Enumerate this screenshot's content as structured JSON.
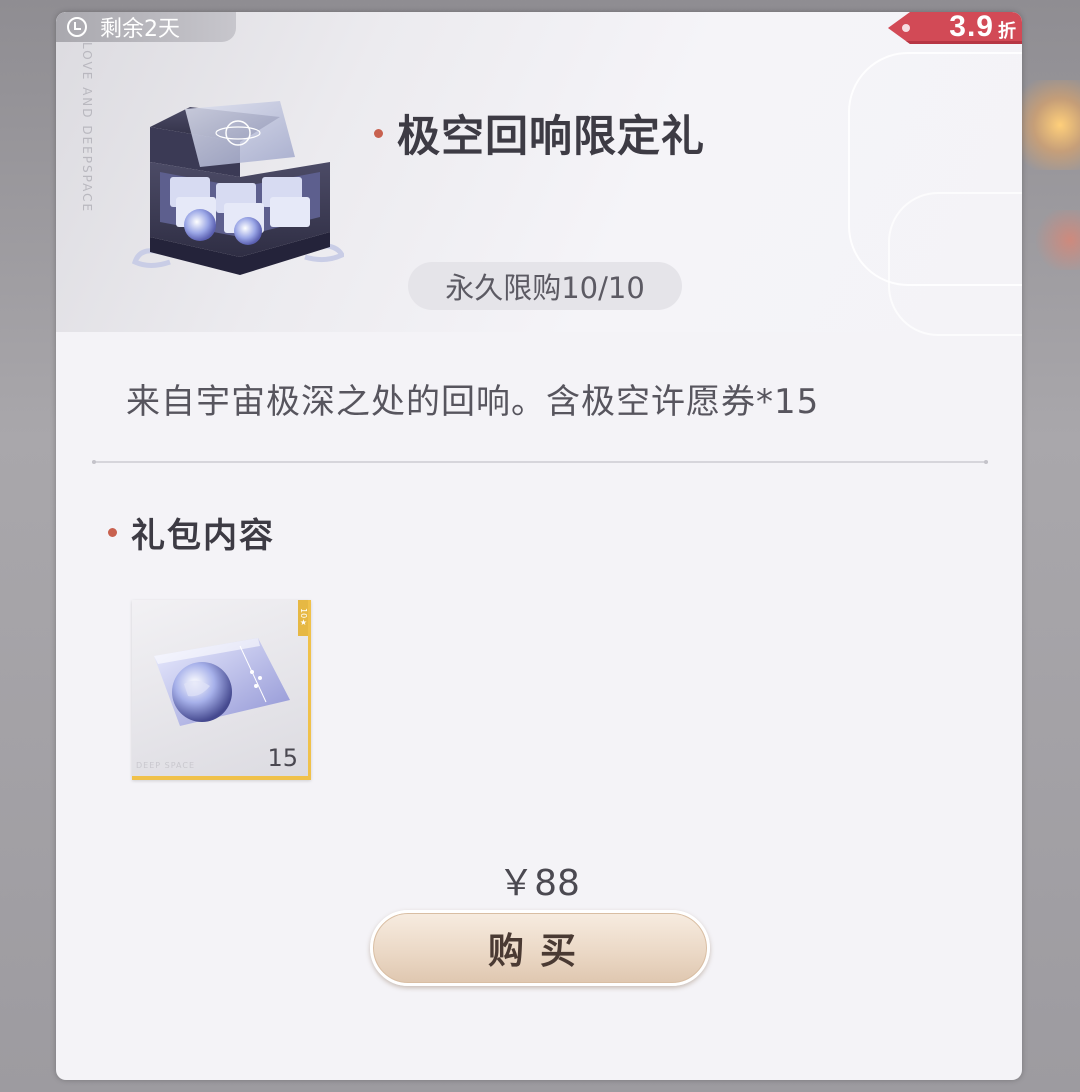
{
  "timer": {
    "icon": "clock-icon",
    "text": "剩余2天"
  },
  "discount": {
    "value": "3.9",
    "unit": "折"
  },
  "package": {
    "title": "极空回响限定礼",
    "limit": "永久限购10/10",
    "description": "来自宇宙极深之处的回响。含极空许愿券*15",
    "side_text": "LOVE AND DEEPSPACE"
  },
  "contents": {
    "section_title": "礼包内容",
    "items": [
      {
        "icon": "wish-ticket-icon",
        "count": "15",
        "label": "DEEP SPACE"
      }
    ]
  },
  "price": "￥88",
  "buy_label": "购买",
  "colors": {
    "accent": "#c8614f",
    "discount_bg": "#d24a56",
    "item_border": "#f0c14a"
  }
}
